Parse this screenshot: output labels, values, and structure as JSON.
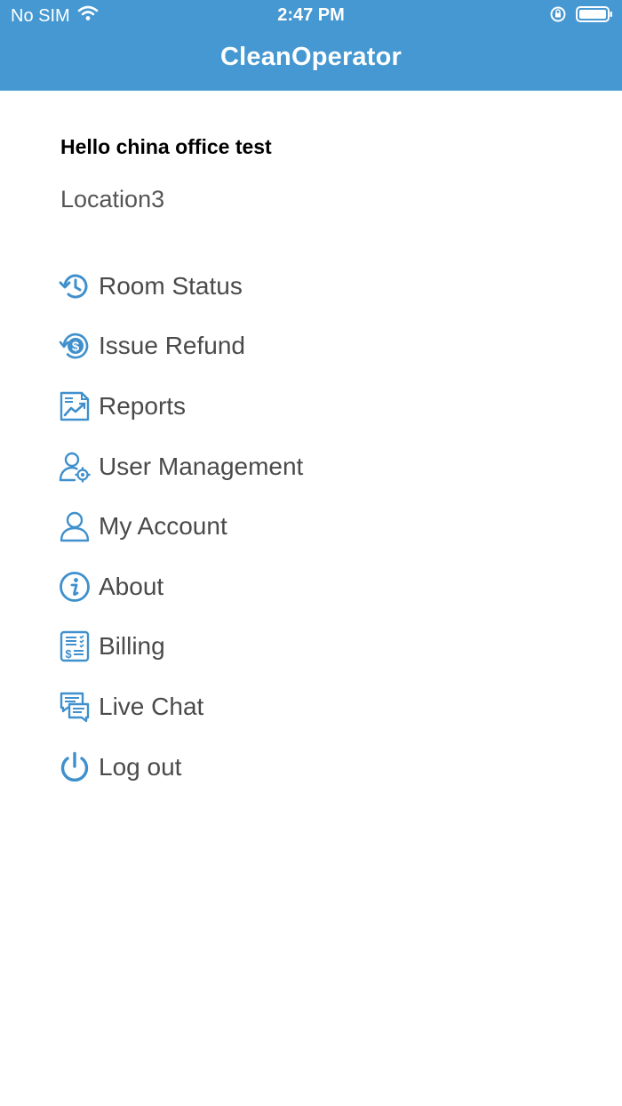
{
  "status_bar": {
    "carrier": "No SIM",
    "time": "2:47 PM"
  },
  "app": {
    "title": "CleanOperator"
  },
  "user": {
    "greeting": "Hello china office test",
    "location": "Location3"
  },
  "menu": {
    "items": [
      {
        "label": "Room Status",
        "icon": "history-clock-icon"
      },
      {
        "label": "Issue Refund",
        "icon": "refund-dollar-icon"
      },
      {
        "label": "Reports",
        "icon": "report-chart-icon"
      },
      {
        "label": "User Management",
        "icon": "user-gear-icon"
      },
      {
        "label": "My Account",
        "icon": "user-icon"
      },
      {
        "label": "About",
        "icon": "info-icon"
      },
      {
        "label": "Billing",
        "icon": "billing-invoice-icon"
      },
      {
        "label": "Live Chat",
        "icon": "chat-icon"
      },
      {
        "label": "Log out",
        "icon": "power-icon"
      }
    ]
  },
  "colors": {
    "header": "#4598d1",
    "icon": "#3f90cc",
    "menu_text": "#4a4a4a"
  }
}
